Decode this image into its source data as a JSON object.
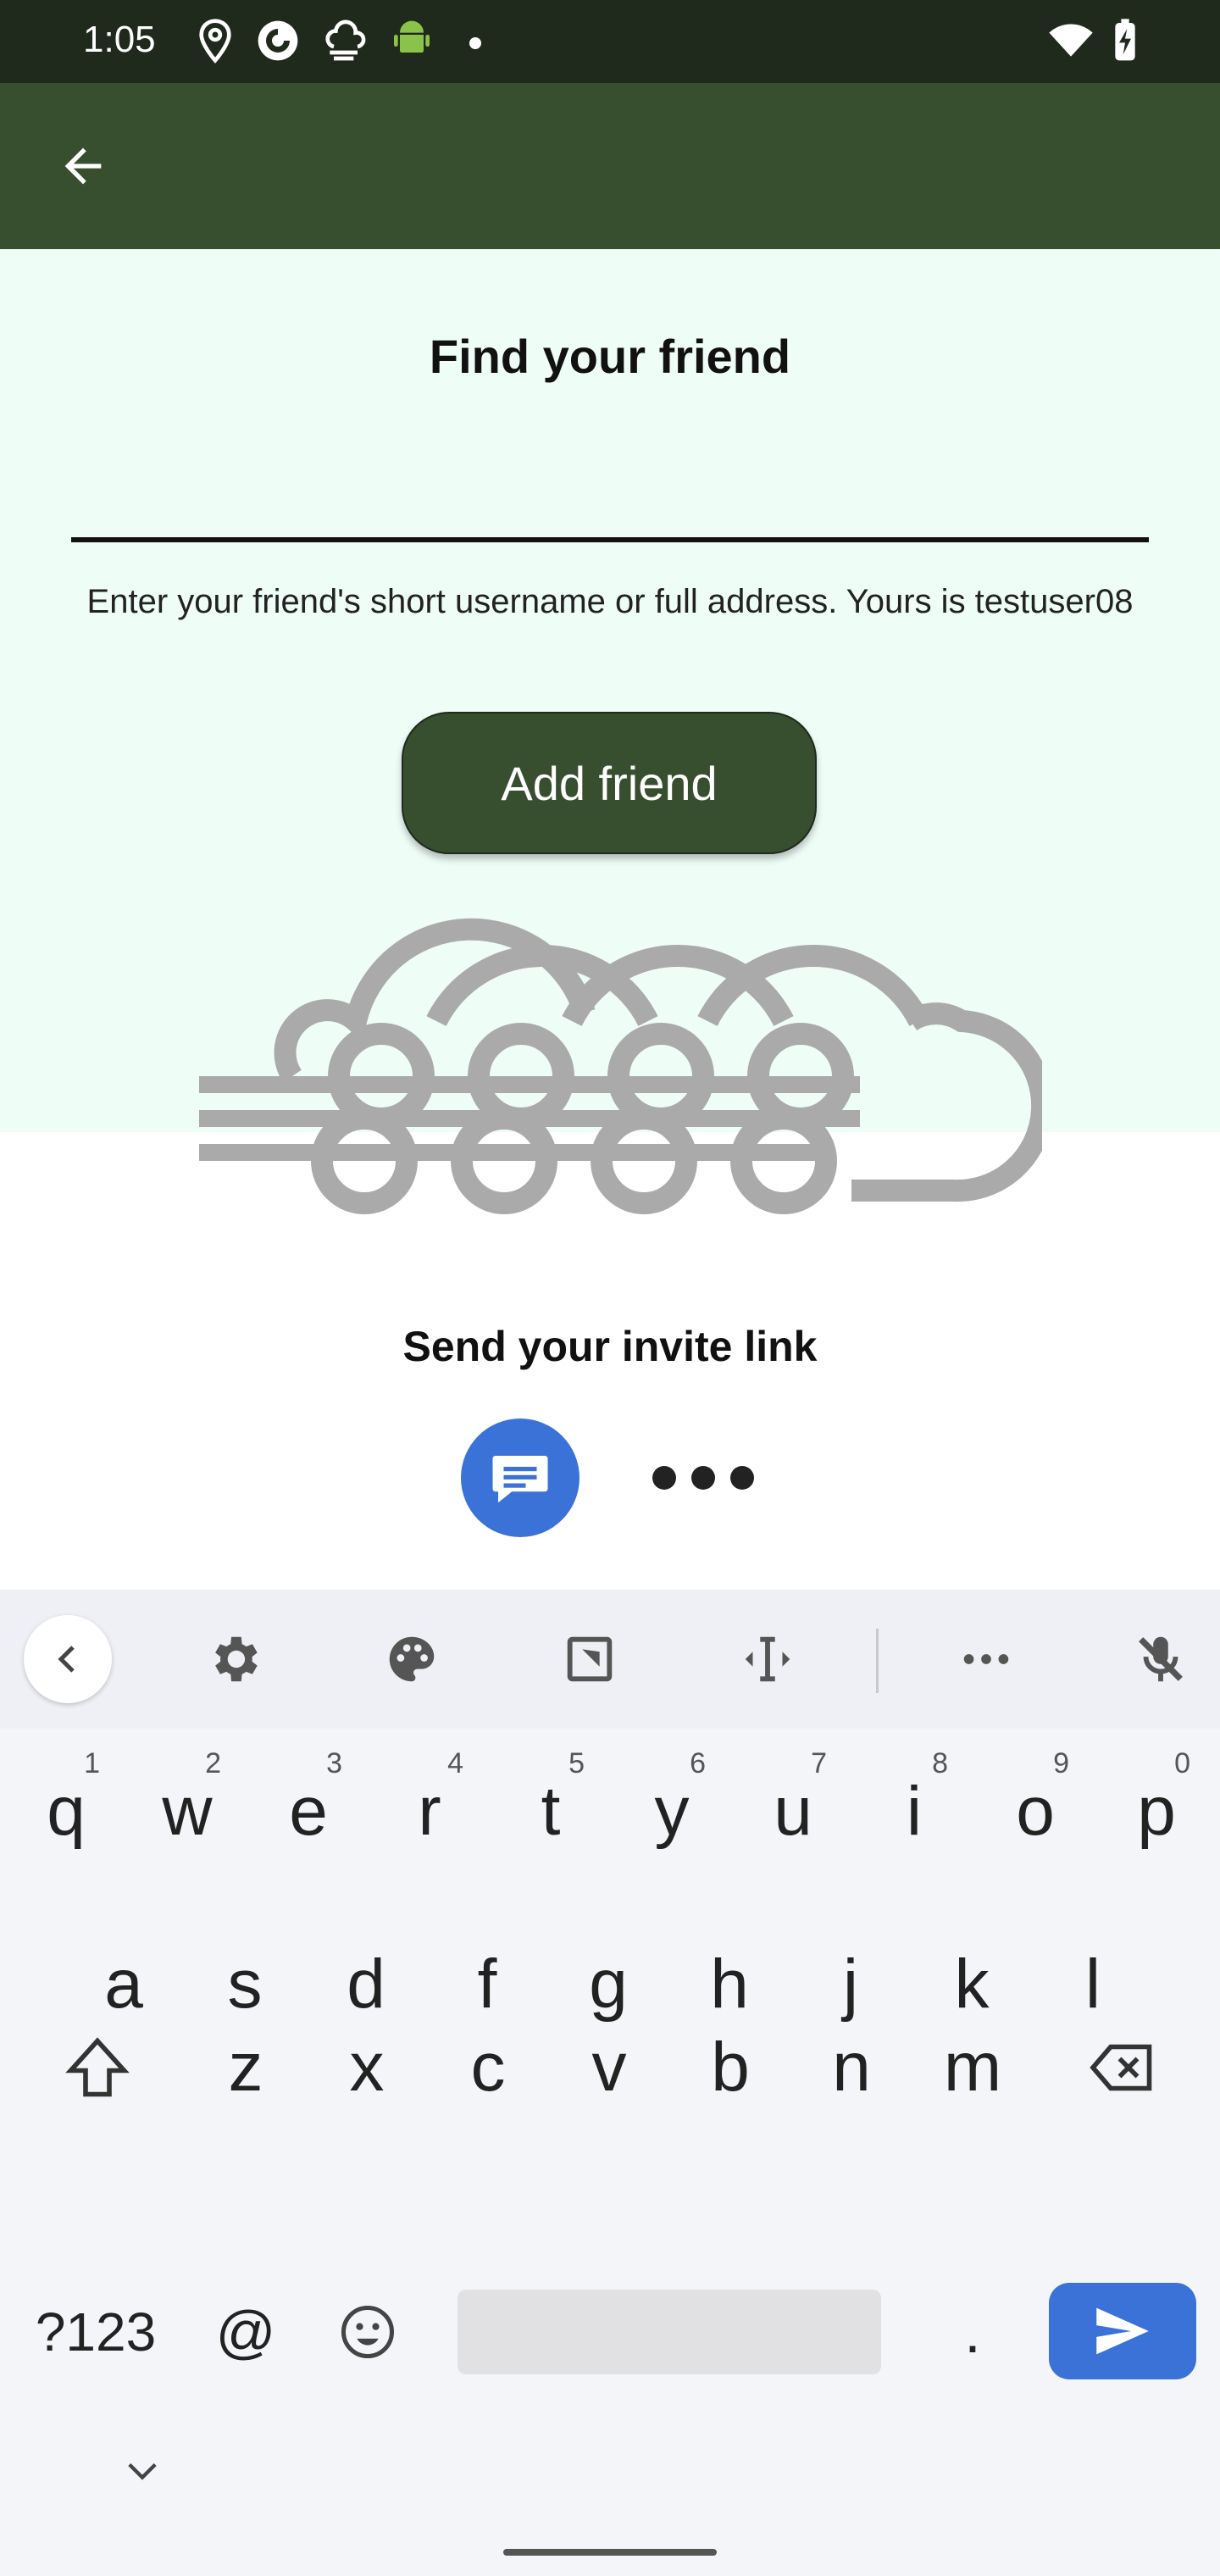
{
  "status_bar": {
    "time": "1:05",
    "icons": [
      "location-icon",
      "camera-app-icon",
      "weather-cloud-icon",
      "android-icon",
      "dot-icon",
      "wifi-icon",
      "battery-charging-icon"
    ]
  },
  "app_bar": {
    "back_icon": "arrow-back-icon"
  },
  "find_friend": {
    "title": "Find your friend",
    "input_value": "",
    "helper": "Enter your friend's short username or full address. Yours is testuser08",
    "add_button": "Add friend"
  },
  "invite": {
    "title": "Send your invite link",
    "share_targets": [
      "messages-icon",
      "more-icon"
    ]
  },
  "keyboard": {
    "toolbar": [
      "collapse-icon",
      "settings-icon",
      "theme-palette-icon",
      "one-handed-icon",
      "cursor-move-icon",
      "more-options-icon",
      "mic-off-icon"
    ],
    "row1": [
      {
        "k": "q",
        "h": "1"
      },
      {
        "k": "w",
        "h": "2"
      },
      {
        "k": "e",
        "h": "3"
      },
      {
        "k": "r",
        "h": "4"
      },
      {
        "k": "t",
        "h": "5"
      },
      {
        "k": "y",
        "h": "6"
      },
      {
        "k": "u",
        "h": "7"
      },
      {
        "k": "i",
        "h": "8"
      },
      {
        "k": "o",
        "h": "9"
      },
      {
        "k": "p",
        "h": "0"
      }
    ],
    "row2": [
      "a",
      "s",
      "d",
      "f",
      "g",
      "h",
      "j",
      "k",
      "l"
    ],
    "row3": [
      "z",
      "x",
      "c",
      "v",
      "b",
      "n",
      "m"
    ],
    "symbols_key": "?123",
    "at_key": "@",
    "period_key": "."
  },
  "colors": {
    "status_bar": "#1f2a1d",
    "app_bar": "#384f2f",
    "panel": "#effdf7",
    "accent_blue": "#3b72d8"
  }
}
